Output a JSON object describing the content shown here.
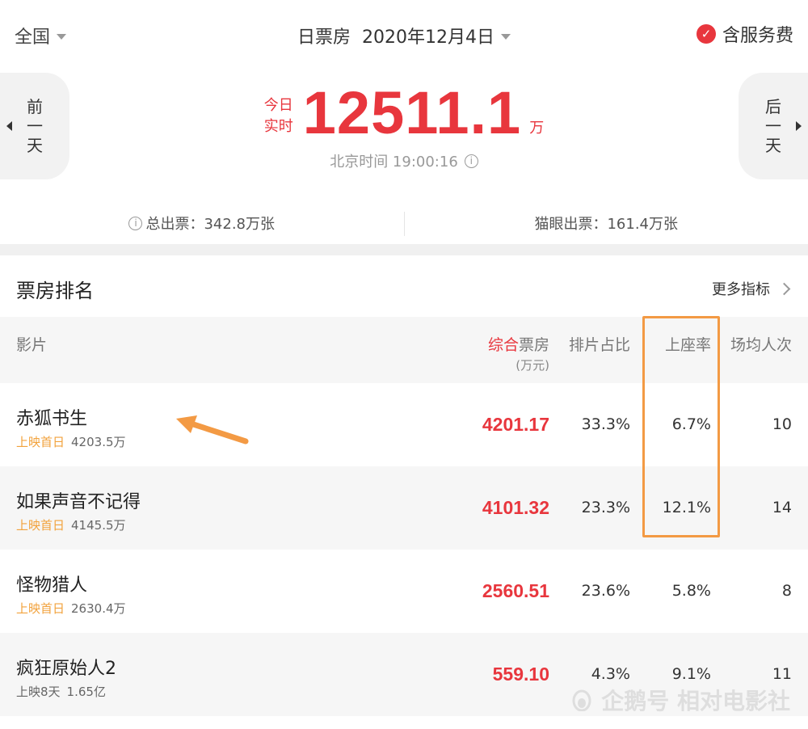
{
  "topbar": {
    "region": "全国",
    "date_label": "日票房",
    "date_value": "2020年12月4日",
    "service_label": "含服务费"
  },
  "nav": {
    "prev": [
      "前",
      "一",
      "天"
    ],
    "next": [
      "后",
      "一",
      "天"
    ]
  },
  "hero": {
    "side_top": "今日",
    "side_bottom": "实时",
    "value": "12511.1",
    "unit": "万",
    "time": "北京时间 19:00:16"
  },
  "stats": {
    "total": "总出票：342.8万张",
    "maoyan": "猫眼出票：161.4万张"
  },
  "ranking": {
    "title": "票房排名",
    "more": "更多指标",
    "columns": {
      "film": "影片",
      "box_red": "综合",
      "box_rest": "票房",
      "box_unit": "(万元)",
      "share": "排片占比",
      "seat": "上座率",
      "avg": "场均人次"
    },
    "rows": [
      {
        "name": "赤狐书生",
        "tag": "上映首日",
        "total": "4203.5万",
        "box": "4201.17",
        "share": "33.3%",
        "seat": "6.7%",
        "avg": "10"
      },
      {
        "name": "如果声音不记得",
        "tag": "上映首日",
        "total": "4145.5万",
        "box": "4101.32",
        "share": "23.3%",
        "seat": "12.1%",
        "avg": "14"
      },
      {
        "name": "怪物猎人",
        "tag": "上映首日",
        "total": "2630.4万",
        "box": "2560.51",
        "share": "23.6%",
        "seat": "5.8%",
        "avg": "8"
      },
      {
        "name": "疯狂原始人2",
        "tag": "上映8天",
        "total": "1.65亿",
        "box": "559.10",
        "share": "4.3%",
        "seat": "9.1%",
        "avg": "11"
      }
    ]
  },
  "watermark": "企鹅号 相对电影社",
  "colors": {
    "accent_red": "#e8363d",
    "tag_orange": "#f2a23c",
    "highlight_orange": "#f39a44"
  }
}
